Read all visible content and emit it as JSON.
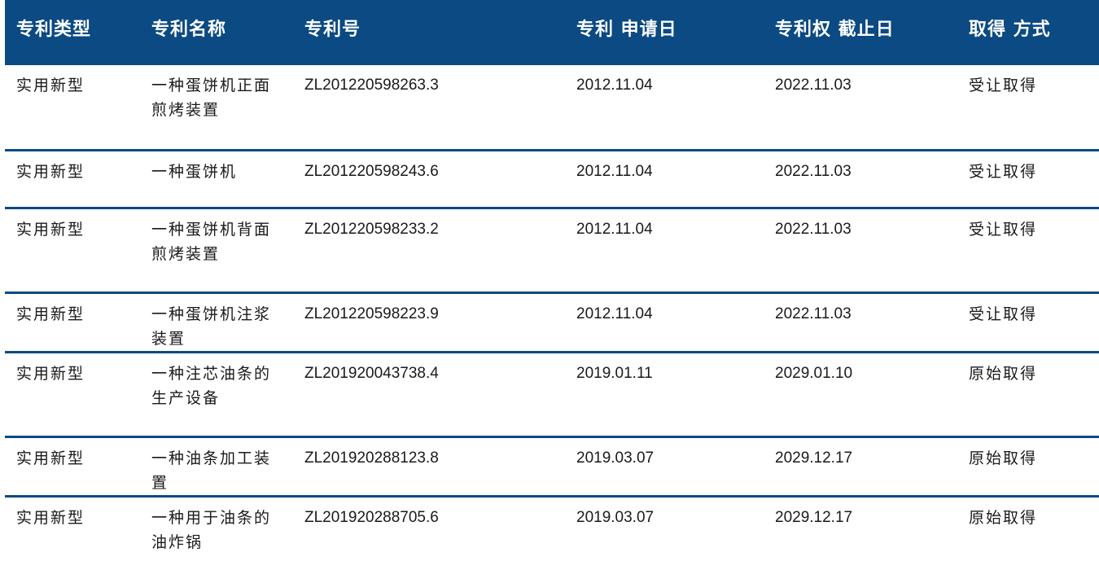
{
  "headers": {
    "type": "专利类型",
    "name": "专利名称",
    "number": "专利号",
    "apply_date": "专利 申请日",
    "expiry_date": "专利权 截止日",
    "acquire_method": "取得 方式"
  },
  "rows": [
    {
      "type": "实用新型",
      "name": "一种蛋饼机正面煎烤装置",
      "number": "ZL201220598263.3",
      "apply_date": "2012.11.04",
      "expiry_date": "2022.11.03",
      "acquire_method": "受让取得"
    },
    {
      "type": "实用新型",
      "name": "一种蛋饼机",
      "number": "ZL201220598243.6",
      "apply_date": "2012.11.04",
      "expiry_date": "2022.11.03",
      "acquire_method": "受让取得"
    },
    {
      "type": "实用新型",
      "name": "一种蛋饼机背面煎烤装置",
      "number": "ZL201220598233.2",
      "apply_date": "2012.11.04",
      "expiry_date": "2022.11.03",
      "acquire_method": "受让取得"
    },
    {
      "type": "实用新型",
      "name": "一种蛋饼机注浆装置",
      "number": "ZL201220598223.9",
      "apply_date": "2012.11.04",
      "expiry_date": "2022.11.03",
      "acquire_method": "受让取得"
    },
    {
      "type": "实用新型",
      "name": "一种注芯油条的生产设备",
      "number": "ZL201920043738.4",
      "apply_date": "2019.01.11",
      "expiry_date": "2029.01.10",
      "acquire_method": "原始取得"
    },
    {
      "type": "实用新型",
      "name": "一种油条加工装置",
      "number": "ZL201920288123.8",
      "apply_date": "2019.03.07",
      "expiry_date": "2029.12.17",
      "acquire_method": "原始取得"
    },
    {
      "type": "实用新型",
      "name": "一种用于油条的油炸锅",
      "number": "ZL201920288705.6",
      "apply_date": "2019.03.07",
      "expiry_date": "2029.12.17",
      "acquire_method": "原始取得"
    }
  ]
}
